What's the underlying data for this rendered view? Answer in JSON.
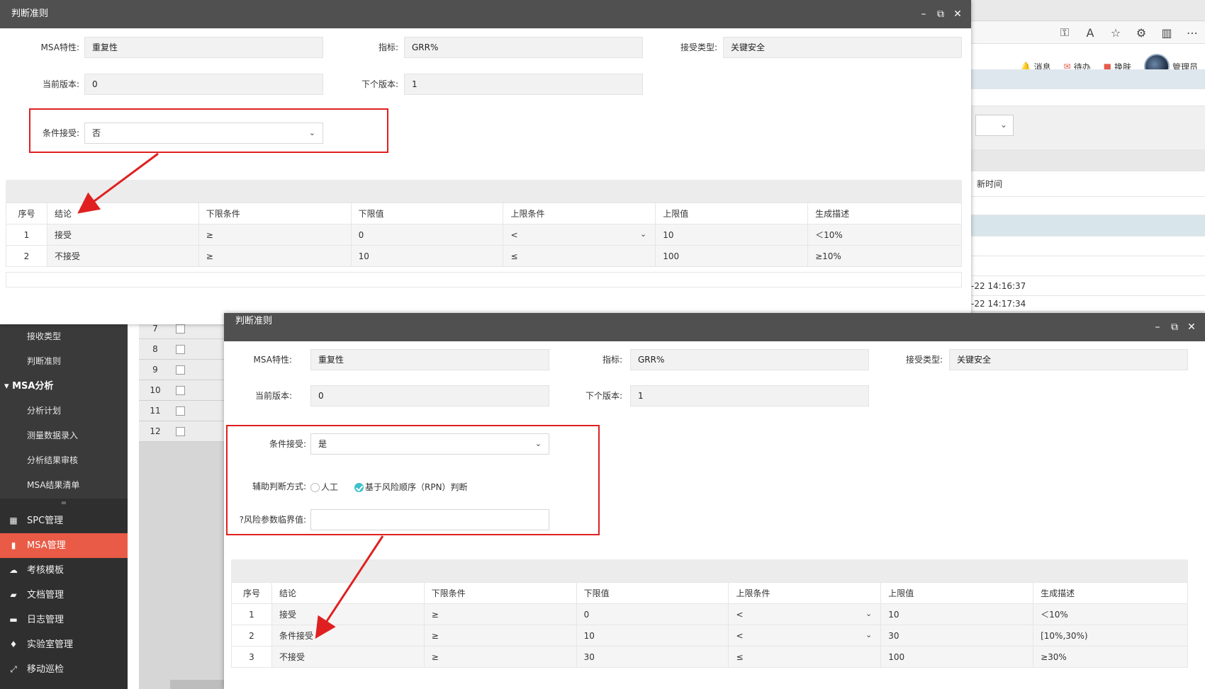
{
  "background_app": {
    "topnav": {
      "messages": "消息",
      "todo": "待办",
      "skin": "换肤",
      "user": "管理员"
    },
    "table_header_partial": "新时间",
    "timestamps": [
      "-22 14:16:37",
      "-22 14:17:34"
    ],
    "sidebar": {
      "sub_items_top": [
        "接收类型",
        "判断准则"
      ],
      "msa_group": "MSA分析",
      "msa_sub_items": [
        "分析计划",
        "测量数据录入",
        "分析结果审核",
        "MSA结果清单"
      ],
      "handle": "=",
      "main_items": [
        {
          "icon": "grid-icon",
          "label": "SPC管理"
        },
        {
          "icon": "document-icon",
          "label": "MSA管理",
          "active": true
        },
        {
          "icon": "cloud-icon",
          "label": "考核模板"
        },
        {
          "icon": "folder-icon",
          "label": "文档管理"
        },
        {
          "icon": "chat-icon",
          "label": "日志管理"
        },
        {
          "icon": "graduation-cap-icon",
          "label": "实验室管理"
        },
        {
          "icon": "expand-icon",
          "label": "移动巡检"
        }
      ]
    },
    "row_numbers": [
      "7",
      "8",
      "9",
      "10",
      "11",
      "12"
    ]
  },
  "dialog1": {
    "title": "判断准则",
    "labels": {
      "msa_char": "MSA特性:",
      "indicator": "指标:",
      "accept_type": "接受类型:",
      "current_version": "当前版本:",
      "next_version": "下个版本:",
      "conditional_accept": "条件接受:"
    },
    "values": {
      "msa_char": "重复性",
      "indicator": "GRR%",
      "accept_type": "关键安全",
      "current_version": "0",
      "next_version": "1",
      "conditional_accept": "否"
    },
    "table": {
      "headers": [
        "序号",
        "结论",
        "下限条件",
        "下限值",
        "上限条件",
        "上限值",
        "生成描述"
      ],
      "rows": [
        [
          "1",
          "接受",
          "≥",
          "0",
          "<",
          "10",
          "＜10%"
        ],
        [
          "2",
          "不接受",
          "≥",
          "10",
          "≤",
          "100",
          "≥10%"
        ]
      ]
    }
  },
  "dialog2": {
    "title": "判断准则",
    "labels": {
      "msa_char": "MSA特性:",
      "indicator": "指标:",
      "accept_type": "接受类型:",
      "current_version": "当前版本:",
      "next_version": "下个版本:",
      "conditional_accept": "条件接受:",
      "aux_method": "辅助判断方式:",
      "risk_threshold": "?风险参数临界值:"
    },
    "values": {
      "msa_char": "重复性",
      "indicator": "GRR%",
      "accept_type": "关键安全",
      "current_version": "0",
      "next_version": "1",
      "conditional_accept": "是",
      "risk_threshold": ""
    },
    "radio_options": [
      {
        "label": "人工",
        "selected": false
      },
      {
        "label": "基于风险顺序（RPN）判断",
        "selected": true
      }
    ],
    "table": {
      "headers": [
        "序号",
        "结论",
        "下限条件",
        "下限值",
        "上限条件",
        "上限值",
        "生成描述"
      ],
      "rows": [
        [
          "1",
          "接受",
          "≥",
          "0",
          "<",
          "10",
          "＜10%"
        ],
        [
          "2",
          "条件接受",
          "≥",
          "10",
          "<",
          "30",
          "[10%,30%)"
        ],
        [
          "3",
          "不接受",
          "≥",
          "30",
          "≤",
          "100",
          "≥30%"
        ]
      ]
    }
  },
  "colors": {
    "title_bar": "#505050",
    "annotation_red": "#e02020",
    "sidebar_active": "#e95b46",
    "radio_selected": "#3ec0c8"
  }
}
